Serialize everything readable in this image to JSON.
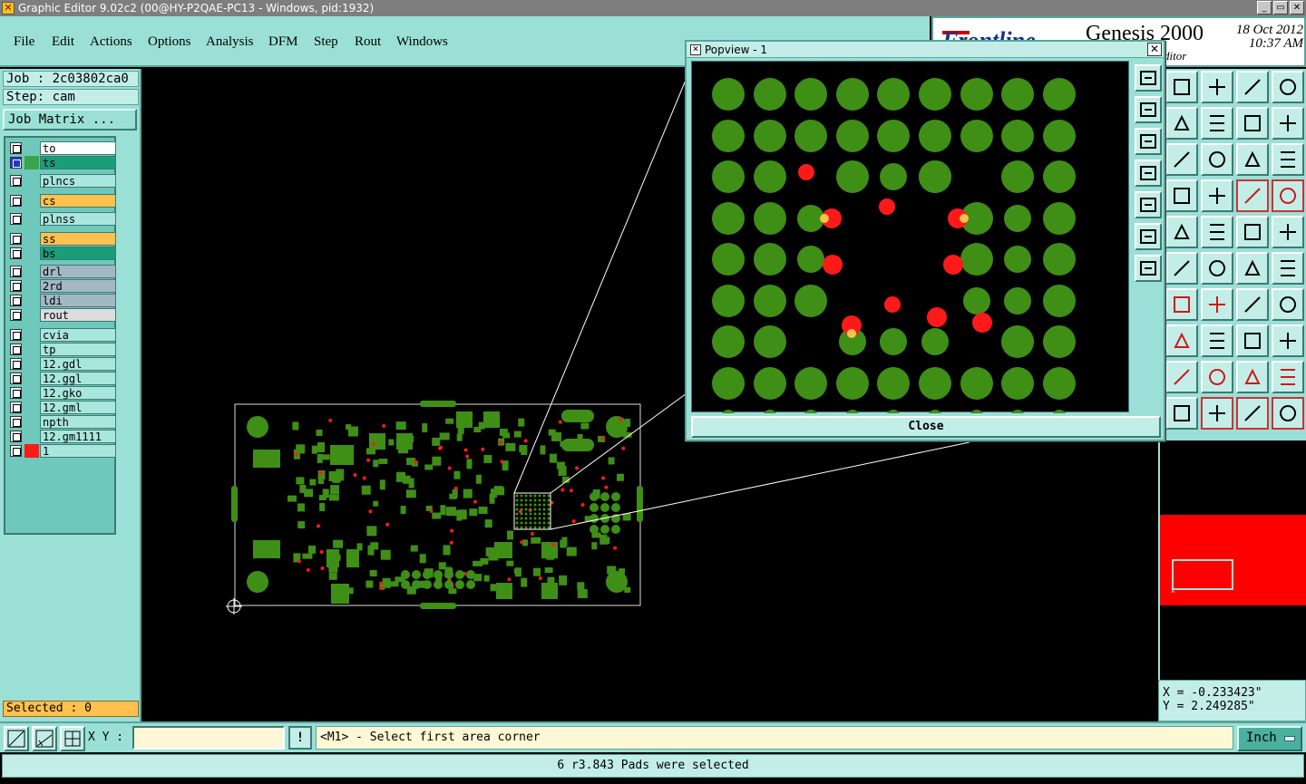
{
  "window": {
    "title": "Graphic Editor 9.02c2 (00@HY-P2QAE-PC13 - Windows, pid:1932)"
  },
  "menu": {
    "items": [
      {
        "label": "File"
      },
      {
        "label": "Edit"
      },
      {
        "label": "Actions"
      },
      {
        "label": "Options"
      },
      {
        "label": "Analysis"
      },
      {
        "label": "DFM"
      },
      {
        "label": "Step"
      },
      {
        "label": "Rout"
      },
      {
        "label": "Windows"
      }
    ]
  },
  "logo": {
    "brand": "Frontline",
    "product": "Genesis 2000",
    "subtitle": "ditor",
    "date": "18 Oct 2012",
    "time": "10:37 AM"
  },
  "job": {
    "job_line": "Job : 2c03802ca0",
    "step_line": "Step: cam",
    "matrix_button": "Job Matrix ..."
  },
  "layers": [
    {
      "name": "to",
      "color": "#ffffff",
      "checked": false
    },
    {
      "name": "ts",
      "color": "#1a9e7a",
      "checked": true,
      "swatch": "#3aa54a"
    },
    {
      "name": "plncs",
      "color": "#a8e6de",
      "checked": false
    },
    {
      "name": "cs",
      "color": "#ffc04d",
      "checked": false
    },
    {
      "name": "plnss",
      "color": "#a8e6de",
      "checked": false
    },
    {
      "name": "ss",
      "color": "#ffc04d",
      "checked": false
    },
    {
      "name": "bs",
      "color": "#1a9e7a",
      "checked": false
    },
    {
      "name": "drl",
      "color": "#a3b8c2",
      "checked": false
    },
    {
      "name": "2rd",
      "color": "#a3b8c2",
      "checked": false
    },
    {
      "name": "ldi",
      "color": "#a3b8c2",
      "checked": false
    },
    {
      "name": "rout",
      "color": "#dcdcdc",
      "checked": false
    },
    {
      "name": "cvia",
      "color": "#a8e6de",
      "checked": false
    },
    {
      "name": "tp",
      "color": "#a8e6de",
      "checked": false
    },
    {
      "name": "12.gdl",
      "color": "#a8e6de",
      "checked": false
    },
    {
      "name": "12.ggl",
      "color": "#a8e6de",
      "checked": false
    },
    {
      "name": "12.gko",
      "color": "#a8e6de",
      "checked": false
    },
    {
      "name": "12.gml",
      "color": "#a8e6de",
      "checked": false
    },
    {
      "name": "npth",
      "color": "#a8e6de",
      "checked": false
    },
    {
      "name": "12.gm1111",
      "color": "#a8e6de",
      "checked": false
    },
    {
      "name": "1",
      "color": "#a8e6de",
      "checked": false,
      "swatch": "#ff1a1a"
    }
  ],
  "selected_text": "Selected : 0",
  "popview": {
    "title": "Popview - 1",
    "close_label": "Close"
  },
  "coords": {
    "x": "X = -0.233423\"",
    "y": "Y = 2.249285\""
  },
  "bottom": {
    "xy_label": "X Y :",
    "xy_value": "",
    "excl": "!",
    "prompt": "<M1> - Select first area corner",
    "unit": "Inch"
  },
  "status": "6 r3.843 Pads were selected",
  "colors": {
    "panel": "#9be0d7",
    "pad_green": "#3f8f16",
    "selected_red": "#ff1a1a",
    "highlight_orange": "#ffc04d"
  }
}
